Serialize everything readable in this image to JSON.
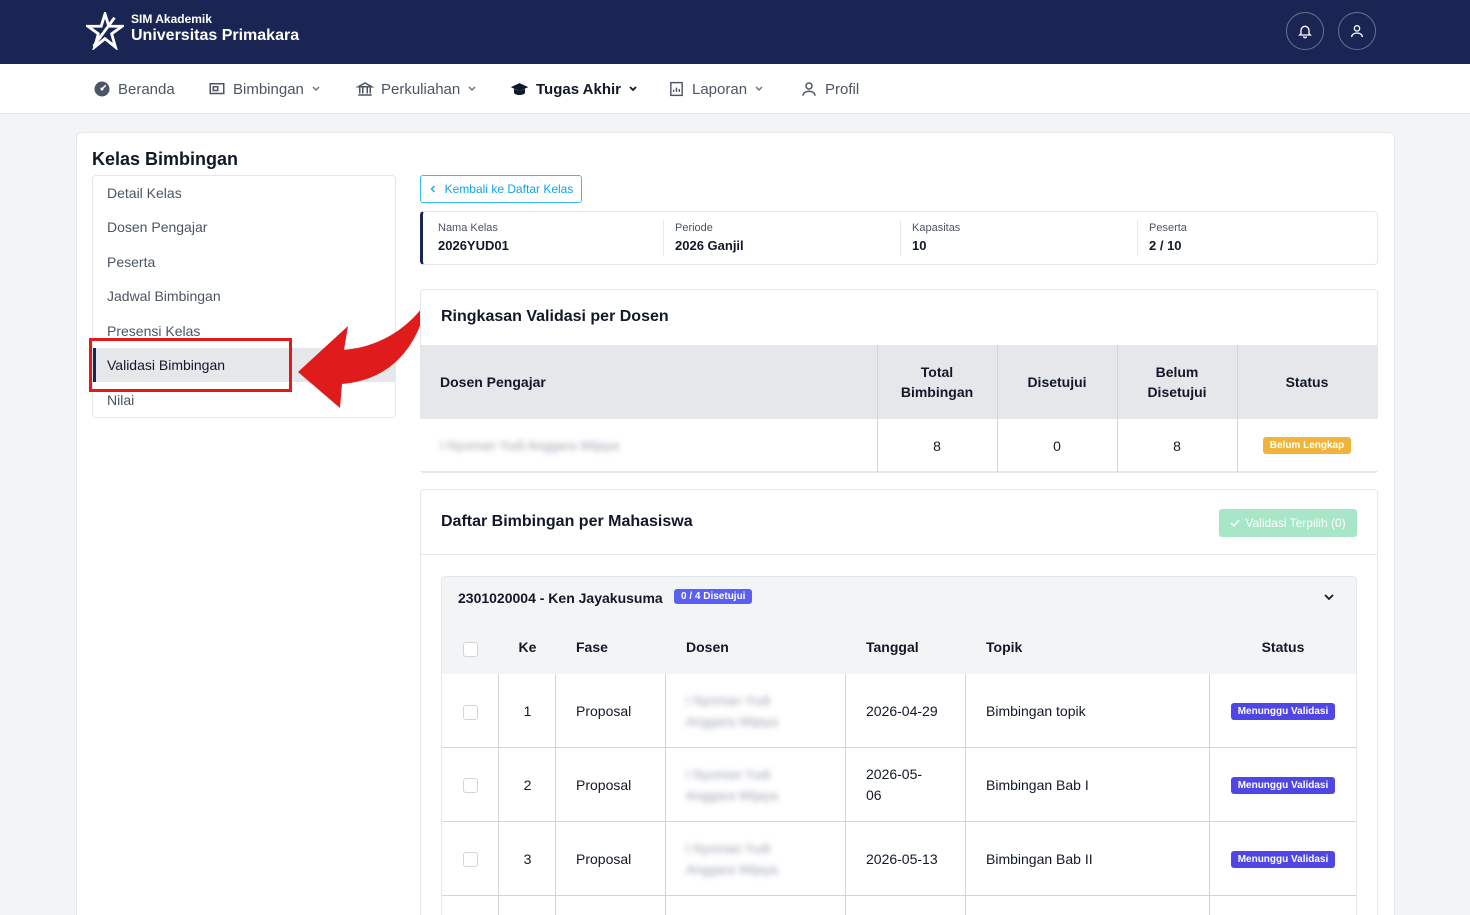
{
  "brand": {
    "sub": "SIM Akademik",
    "name": "Universitas Primakara"
  },
  "header": {
    "notification_icon": "bell-icon",
    "profile_icon": "user-icon"
  },
  "nav": [
    {
      "label": "Beranda",
      "icon": "dashboard-icon",
      "dropdown": false
    },
    {
      "label": "Bimbingan",
      "icon": "presentation-icon",
      "dropdown": true
    },
    {
      "label": "Perkuliahan",
      "icon": "institution-icon",
      "dropdown": true
    },
    {
      "label": "Tugas Akhir",
      "icon": "graduation-cap-icon",
      "dropdown": true,
      "active": true
    },
    {
      "label": "Laporan",
      "icon": "report-icon",
      "dropdown": true
    },
    {
      "label": "Profil",
      "icon": "user-icon",
      "dropdown": false
    }
  ],
  "page": {
    "title": "Kelas Bimbingan",
    "back_button": "Kembali ke Daftar Kelas"
  },
  "sidebar": {
    "items": [
      {
        "label": "Detail Kelas"
      },
      {
        "label": "Dosen Pengajar"
      },
      {
        "label": "Peserta"
      },
      {
        "label": "Jadwal Bimbingan"
      },
      {
        "label": "Presensi Kelas"
      },
      {
        "label": "Validasi Bimbingan",
        "active": true
      },
      {
        "label": "Nilai"
      }
    ]
  },
  "class_info": [
    {
      "label": "Nama Kelas",
      "value": "2026YUD01"
    },
    {
      "label": "Periode",
      "value": "2026 Ganjil"
    },
    {
      "label": "Kapasitas",
      "value": "10"
    },
    {
      "label": "Peserta",
      "value": "2 / 10"
    }
  ],
  "summary": {
    "title": "Ringkasan Validasi per Dosen",
    "headers": [
      "Dosen Pengajar",
      "Total Bimbingan",
      "Disetujui",
      "Belum Disetujui",
      "Status"
    ],
    "row": {
      "dosen": "I Nyoman Yudi Anggara Wijaya",
      "total": "8",
      "approved": "0",
      "pending": "8",
      "status": "Belum Lengkap"
    }
  },
  "students": {
    "title": "Daftar Bimbingan per Mahasiswa",
    "validate_button": "Validasi Terpilih (0)",
    "student_label": "2301020004 - Ken Jayakusuma",
    "progress_badge": "0 / 4 Disetujui",
    "table_headers": [
      "Ke",
      "Fase",
      "Dosen",
      "Tanggal",
      "Topik",
      "Status"
    ],
    "rows": [
      {
        "no": "1",
        "phase": "Proposal",
        "dosen_line1": "I Nyoman Yudi",
        "dosen_line2": "Anggara Wijaya",
        "date_line1": "2026-04-29",
        "date_line2": "",
        "topic": "Bimbingan topik",
        "status": "Menunggu Validasi"
      },
      {
        "no": "2",
        "phase": "Proposal",
        "dosen_line1": "I Nyoman Yudi",
        "dosen_line2": "Anggara Wijaya",
        "date_line1": "2026-05-",
        "date_line2": "06",
        "topic": "Bimbingan Bab I",
        "status": "Menunggu Validasi"
      },
      {
        "no": "3",
        "phase": "Proposal",
        "dosen_line1": "I Nyoman Yudi",
        "dosen_line2": "Anggara Wijaya",
        "date_line1": "2026-05-13",
        "date_line2": "",
        "topic": "Bimbingan Bab II",
        "status": "Menunggu Validasi"
      }
    ]
  },
  "colors": {
    "navy": "#1b2554",
    "accent_red": "#e01b1b",
    "warn": "#f0b43a",
    "indigo": "#4f46e5",
    "success_light": "#a7e6c7"
  }
}
